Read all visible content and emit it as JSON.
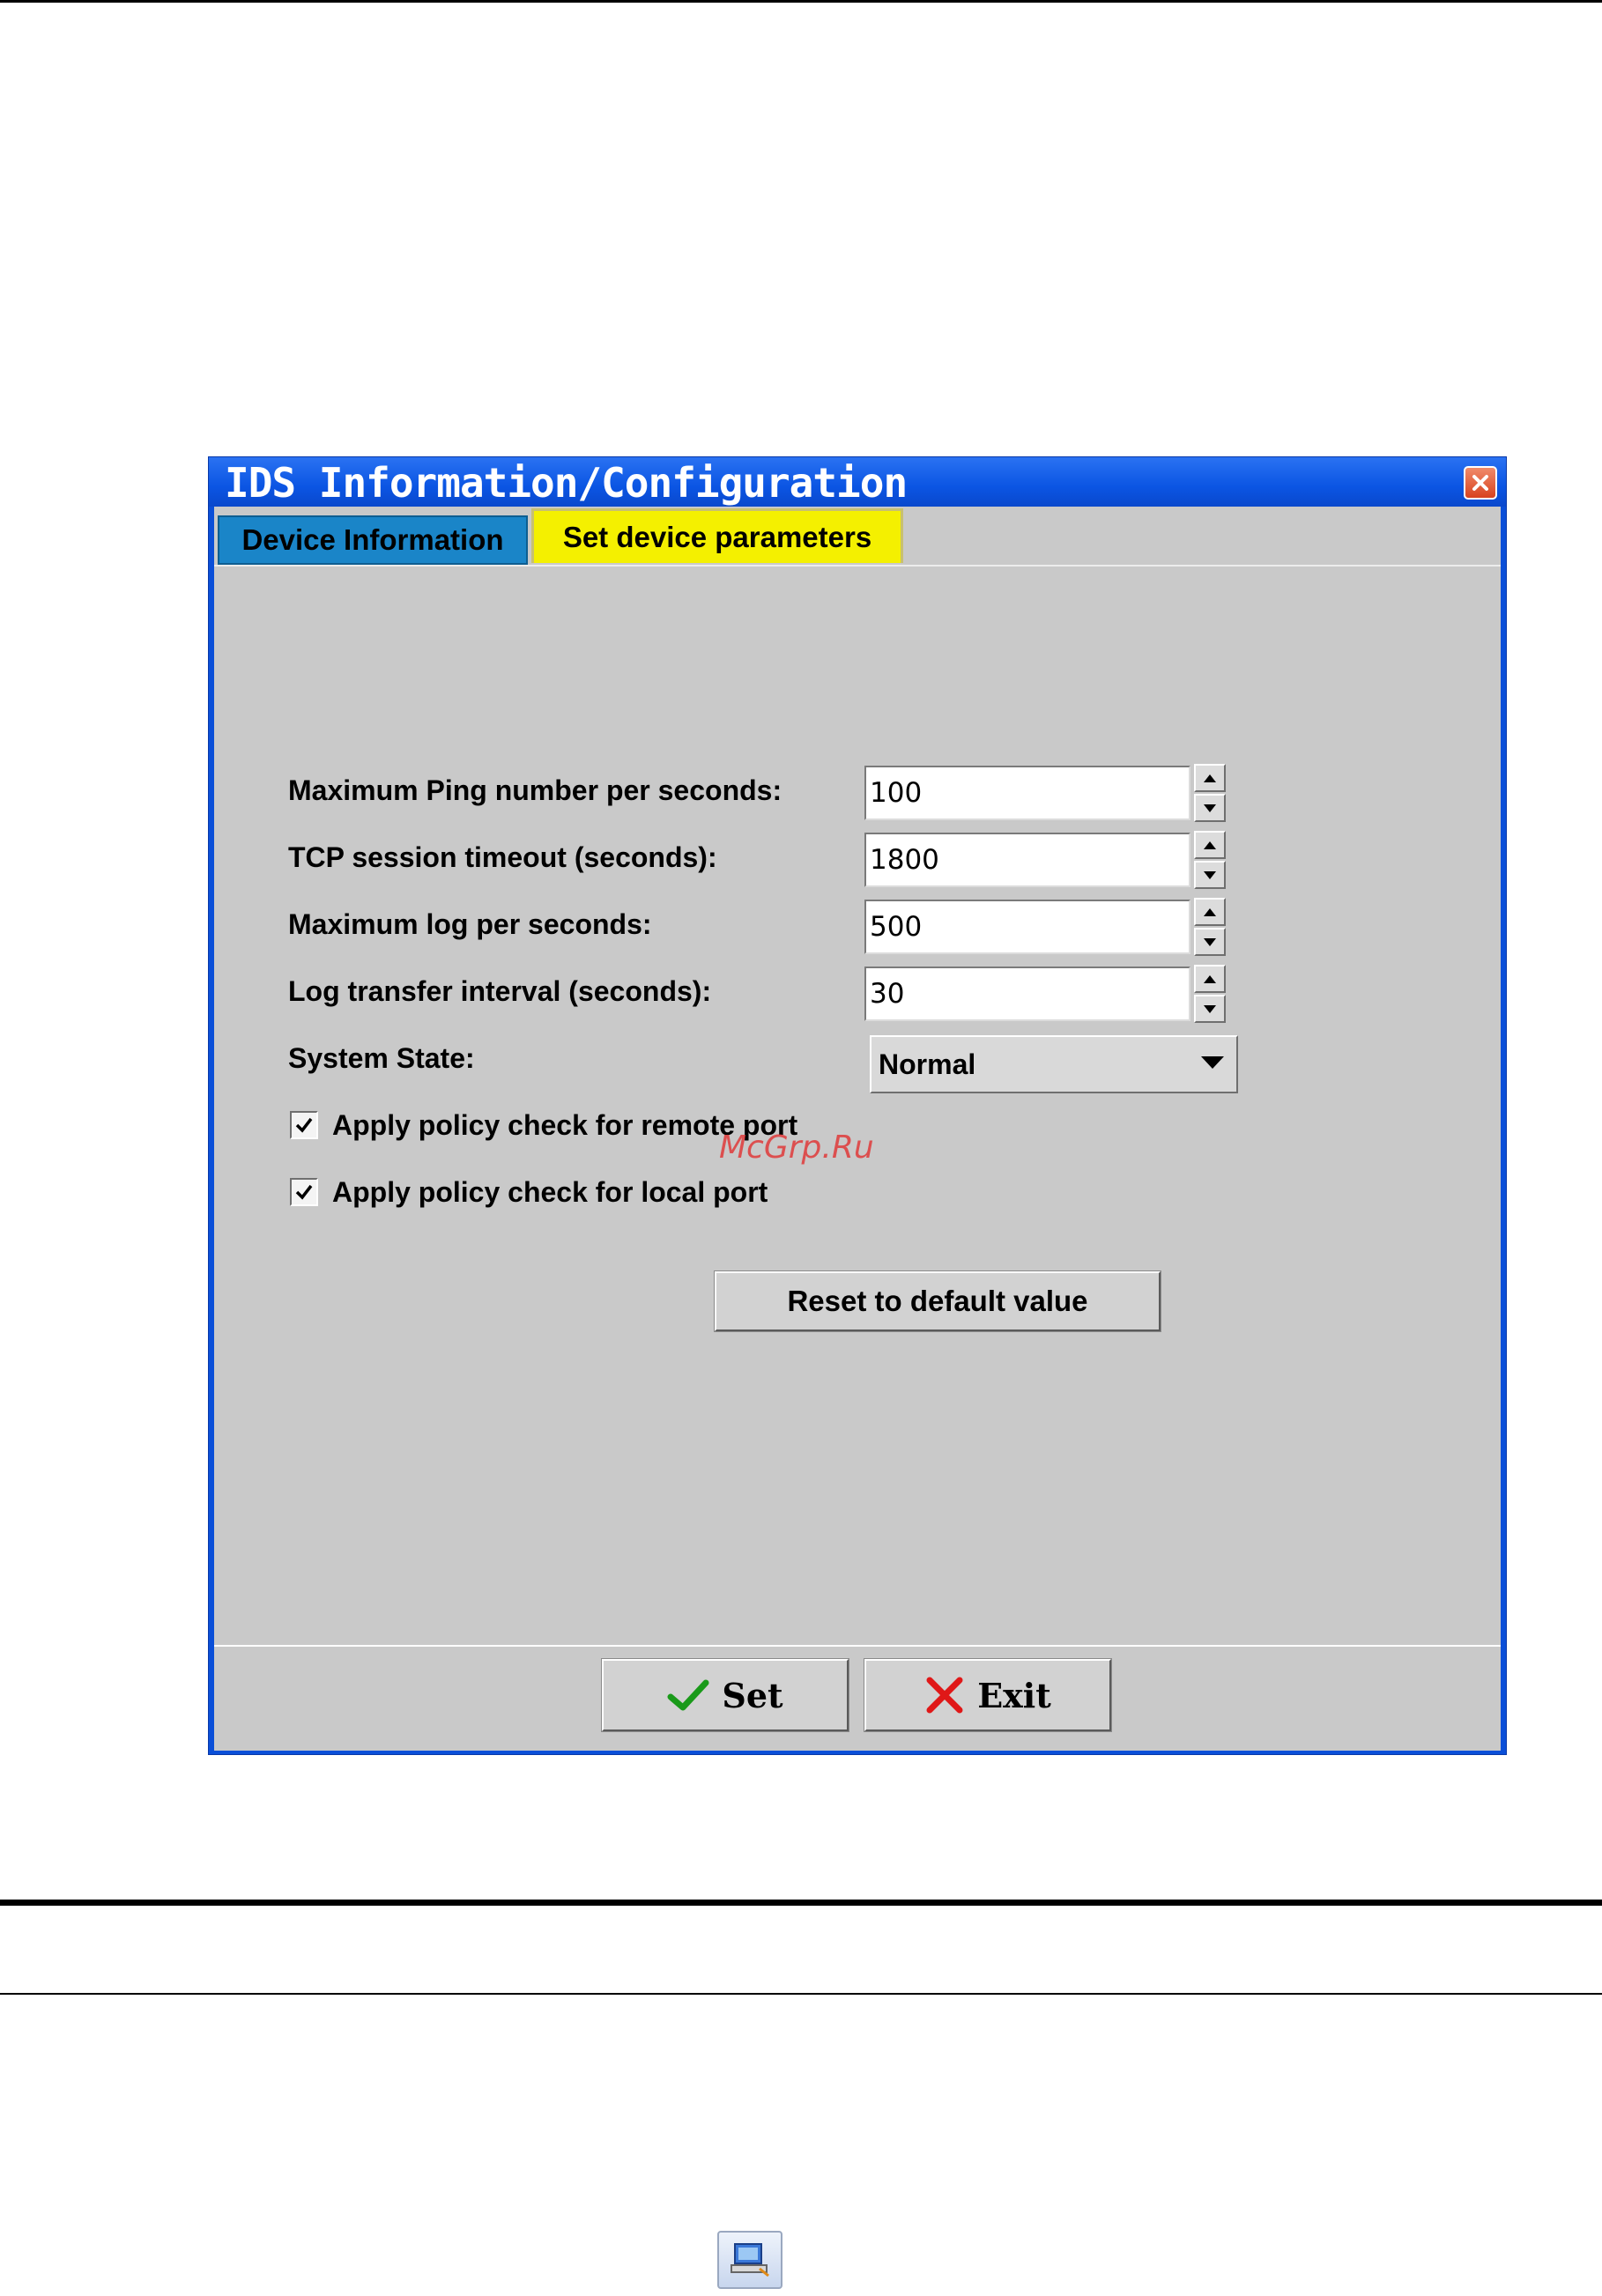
{
  "window": {
    "title": "IDS Information/Configuration",
    "close_icon": "close-icon"
  },
  "tabs": [
    {
      "label": "Device Information",
      "active": false
    },
    {
      "label": "Set device parameters",
      "active": true
    }
  ],
  "params": {
    "max_ping": {
      "label": "Maximum Ping number per seconds:",
      "value": "100"
    },
    "tcp_timeout": {
      "label": "TCP session timeout (seconds):",
      "value": "1800"
    },
    "max_log": {
      "label": "Maximum log per seconds:",
      "value": "500"
    },
    "log_interval": {
      "label": "Log transfer interval (seconds):",
      "value": "30"
    },
    "system_state": {
      "label": "System State:",
      "value": "Normal"
    }
  },
  "checks": {
    "remote_port": {
      "label": "Apply policy check for remote port",
      "checked": true
    },
    "local_port": {
      "label": "Apply policy check for local port",
      "checked": true
    }
  },
  "buttons": {
    "reset": "Reset to default value",
    "set": "Set",
    "exit": "Exit"
  },
  "watermark": "McGrp.Ru",
  "colors": {
    "titlebar": "#0b55e3",
    "tab_active": "#f4f000",
    "tab_inactive": "#1a85c8",
    "panel": "#c9c9c9",
    "set_check": "#1a9a1a",
    "exit_x": "#e01818"
  }
}
